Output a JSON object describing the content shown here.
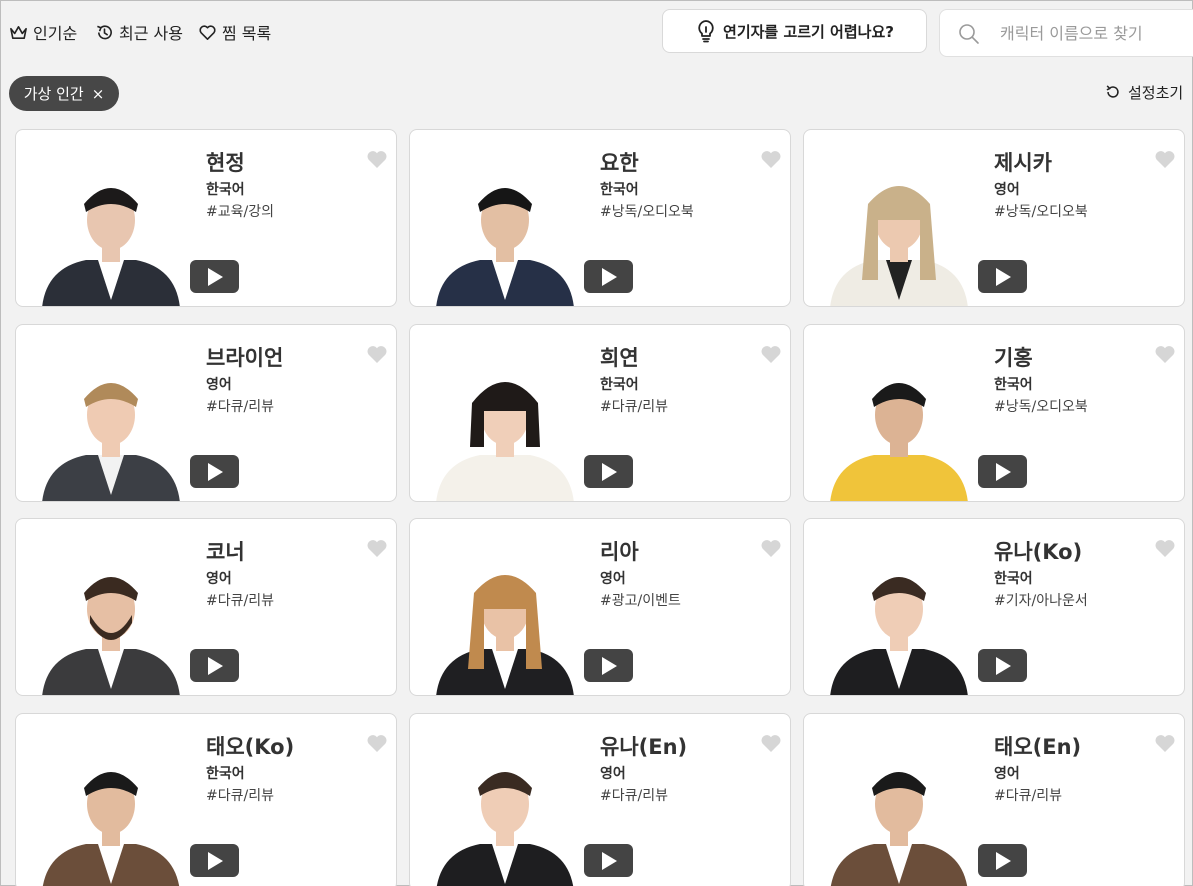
{
  "sort_tabs": [
    {
      "label": "인기순",
      "icon": "crown-icon"
    },
    {
      "label": "최근 사용",
      "icon": "history-icon"
    },
    {
      "label": "찜 목록",
      "icon": "heart-outline-icon"
    }
  ],
  "help_button": {
    "label": "연기자를 고르기 어렵나요?",
    "icon": "lightbulb-icon"
  },
  "search": {
    "placeholder": "캐릭터 이름으로 찾기",
    "value": ""
  },
  "filter_chip": {
    "label": "가상 인간",
    "remove_symbol": "×"
  },
  "reset_button": {
    "label": "설정초기",
    "icon": "reset-icon"
  },
  "colors": {
    "background": "#f2f2f2",
    "card": "#ffffff",
    "chip": "#474747",
    "play_button": "#444444",
    "heart_inactive": "#d6d6d6"
  },
  "characters": [
    {
      "name": "현정",
      "language": "한국어",
      "tag": "#교육/강의",
      "suit": "#2b2f38",
      "shirt": "#ffffff",
      "hair": "#1c1a1a",
      "skin": "#e8c6b0",
      "hair_style": "short"
    },
    {
      "name": "요한",
      "language": "한국어",
      "tag": "#낭독/오디오북",
      "suit": "#263047",
      "shirt": "#ffffff",
      "hair": "#161616",
      "skin": "#e3bfa3",
      "hair_style": "short"
    },
    {
      "name": "제시카",
      "language": "영어",
      "tag": "#낭독/오디오북",
      "suit": "#efece4",
      "shirt": "#222222",
      "hair": "#c9b18a",
      "skin": "#ecc9b0",
      "hair_style": "long"
    },
    {
      "name": "브라이언",
      "language": "영어",
      "tag": "#다큐/리뷰",
      "suit": "#3c3f45",
      "shirt": "#f2f2f2",
      "hair": "#b08a5a",
      "skin": "#efcbb3",
      "hair_style": "short"
    },
    {
      "name": "희연",
      "language": "한국어",
      "tag": "#다큐/리뷰",
      "suit": "#f4f1ea",
      "shirt": "#f4f1ea",
      "hair": "#1f1a18",
      "skin": "#f0cfb9",
      "hair_style": "bob"
    },
    {
      "name": "기홍",
      "language": "한국어",
      "tag": "#낭독/오디오북",
      "suit": "#f0c43a",
      "shirt": "#f0c43a",
      "hair": "#1a1a1a",
      "skin": "#dcb394",
      "hair_style": "short"
    },
    {
      "name": "코너",
      "language": "영어",
      "tag": "#다큐/리뷰",
      "suit": "#3b3b3d",
      "shirt": "#ffffff",
      "hair": "#3a2a20",
      "skin": "#e6bfa4",
      "hair_style": "beard"
    },
    {
      "name": "리아",
      "language": "영어",
      "tag": "#광고/이벤트",
      "suit": "#1f1f22",
      "shirt": "#ffffff",
      "hair": "#c08a4e",
      "skin": "#e9c2a6",
      "hair_style": "long"
    },
    {
      "name": "유나(Ko)",
      "language": "한국어",
      "tag": "#기자/아나운서",
      "suit": "#1e1e20",
      "shirt": "#ffffff",
      "hair": "#3a2b22",
      "skin": "#efcdb6",
      "hair_style": "short"
    },
    {
      "name": "태오(Ko)",
      "language": "한국어",
      "tag": "#다큐/리뷰",
      "suit": "#6b4e3a",
      "shirt": "#ffffff",
      "hair": "#1a1a1a",
      "skin": "#e2bb9e",
      "hair_style": "short"
    },
    {
      "name": "유나(En)",
      "language": "영어",
      "tag": "#다큐/리뷰",
      "suit": "#1e1e20",
      "shirt": "#ffffff",
      "hair": "#3a2b22",
      "skin": "#efcdb6",
      "hair_style": "short"
    },
    {
      "name": "태오(En)",
      "language": "영어",
      "tag": "#다큐/리뷰",
      "suit": "#6b4e3a",
      "shirt": "#ffffff",
      "hair": "#1a1a1a",
      "skin": "#e2bb9e",
      "hair_style": "short"
    }
  ]
}
